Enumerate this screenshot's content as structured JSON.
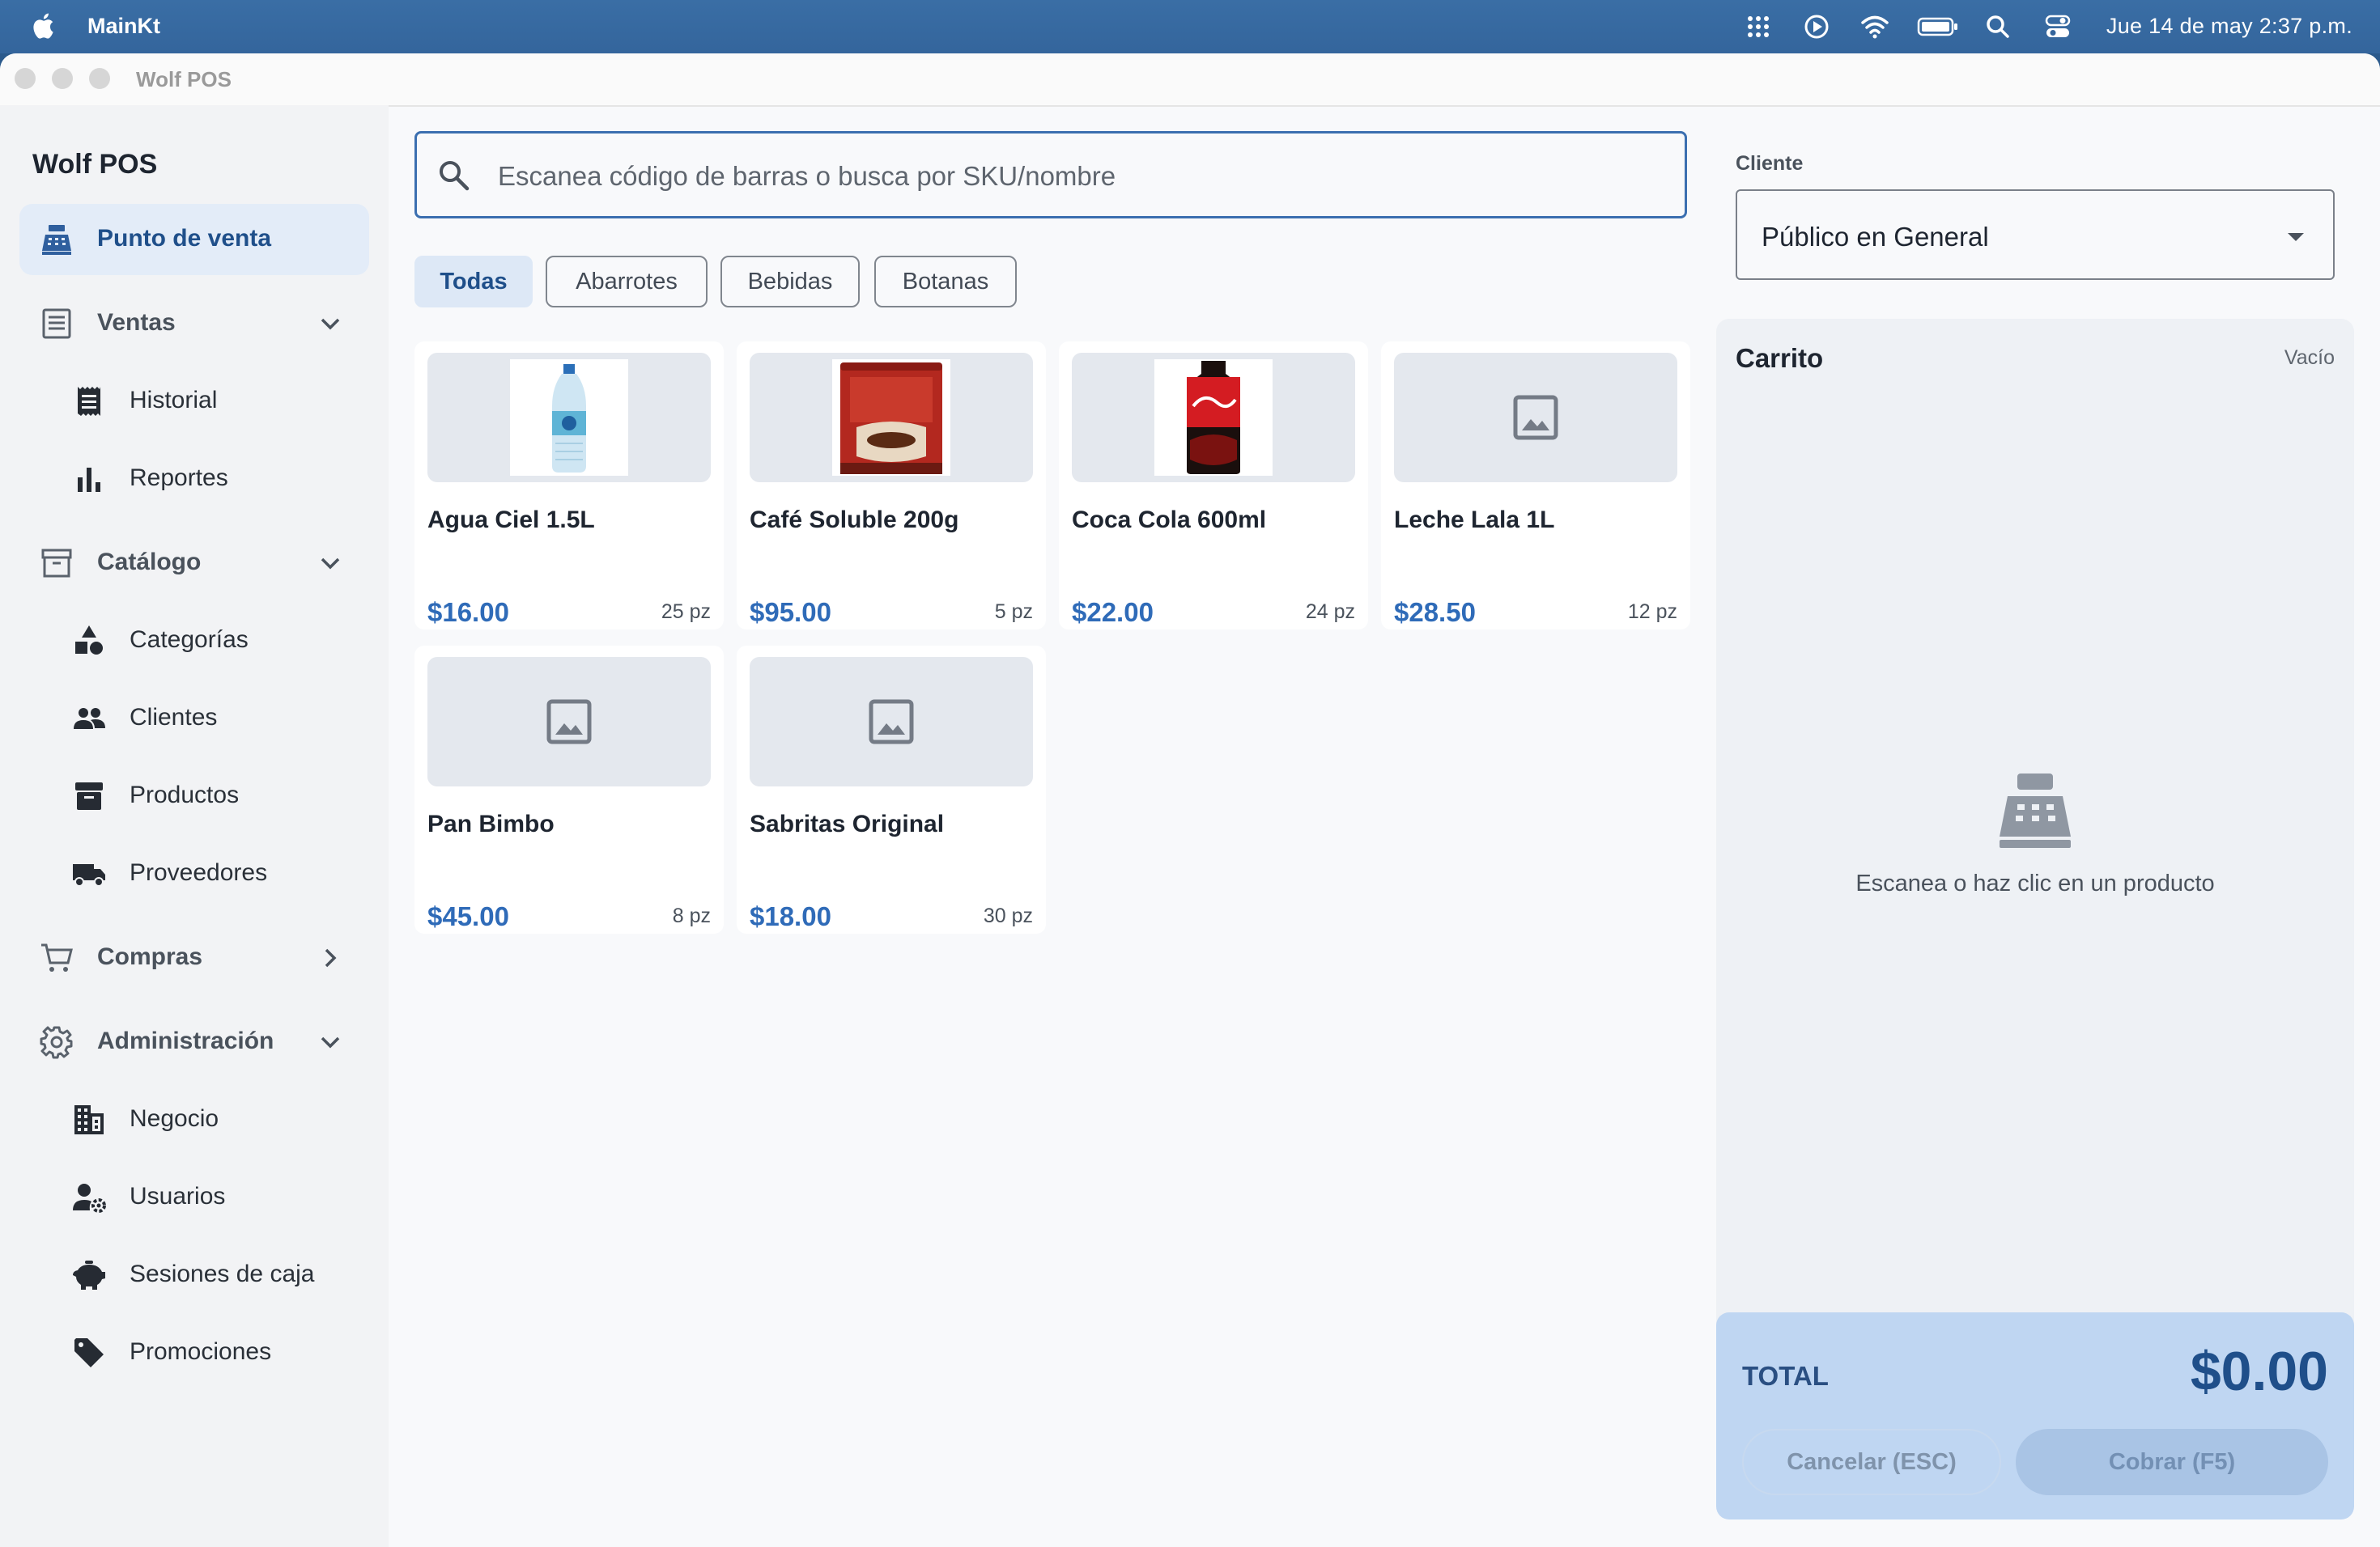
{
  "menubar": {
    "app_name": "MainKt",
    "clock": "Jue 14 de may  2:37 p.m.",
    "icons": [
      "apple-icon",
      "control-center-dots-icon",
      "play-icon",
      "wifi-icon",
      "battery-icon",
      "spotlight-search-icon",
      "control-center-toggle-icon"
    ]
  },
  "window": {
    "title": "Wolf POS"
  },
  "sidebar": {
    "title": "Wolf POS",
    "items": [
      {
        "label": "Punto de venta",
        "icon": "cash-register-icon",
        "active": true
      },
      {
        "label": "Ventas",
        "icon": "receipt-list-icon",
        "expanded": true
      },
      {
        "label": "Historial",
        "icon": "receipt-icon"
      },
      {
        "label": "Reportes",
        "icon": "bar-chart-icon"
      },
      {
        "label": "Catálogo",
        "icon": "archive-box-icon",
        "expanded": true
      },
      {
        "label": "Categorías",
        "icon": "shapes-icon"
      },
      {
        "label": "Clientes",
        "icon": "people-icon"
      },
      {
        "label": "Productos",
        "icon": "inventory-box-icon"
      },
      {
        "label": "Proveedores",
        "icon": "truck-icon"
      },
      {
        "label": "Compras",
        "icon": "shopping-cart-icon",
        "expanded": false
      },
      {
        "label": "Administración",
        "icon": "gear-icon",
        "expanded": true
      },
      {
        "label": "Negocio",
        "icon": "building-icon"
      },
      {
        "label": "Usuarios",
        "icon": "user-settings-icon"
      },
      {
        "label": "Sesiones de caja",
        "icon": "piggy-bank-icon"
      },
      {
        "label": "Promociones",
        "icon": "tag-icon"
      }
    ]
  },
  "search": {
    "placeholder": "Escanea código de barras o busca por SKU/nombre"
  },
  "filters": [
    {
      "label": "Todas",
      "active": true
    },
    {
      "label": "Abarrotes"
    },
    {
      "label": "Bebidas"
    },
    {
      "label": "Botanas"
    }
  ],
  "products": [
    {
      "name": "Agua Ciel 1.5L",
      "price": "$16.00",
      "stock": "25 pz",
      "image": "water-bottle"
    },
    {
      "name": "Café Soluble 200g",
      "price": "$95.00",
      "stock": "5 pz",
      "image": "coffee-can"
    },
    {
      "name": "Coca Cola 600ml",
      "price": "$22.00",
      "stock": "24 pz",
      "image": "soda-bottle"
    },
    {
      "name": "Leche Lala 1L",
      "price": "$28.50",
      "stock": "12 pz",
      "image": "placeholder"
    },
    {
      "name": "Pan Bimbo",
      "price": "$45.00",
      "stock": "8 pz",
      "image": "placeholder"
    },
    {
      "name": "Sabritas Original",
      "price": "$18.00",
      "stock": "30 pz",
      "image": "placeholder"
    }
  ],
  "client": {
    "label": "Cliente",
    "value": "Público en General"
  },
  "cart": {
    "title": "Carrito",
    "state": "Vacío",
    "empty_message": "Escanea o haz clic en un producto",
    "empty_icon": "cash-register-icon"
  },
  "totals": {
    "label": "TOTAL",
    "value": "$0.00",
    "cancel_label": "Cancelar (ESC)",
    "pay_label": "Cobrar (F5)"
  },
  "colors": {
    "accent": "#2f6bb8",
    "active_nav_bg": "#e3ecf8",
    "total_bg": "#bfd6f2",
    "menubar": "#3a6ea5"
  }
}
